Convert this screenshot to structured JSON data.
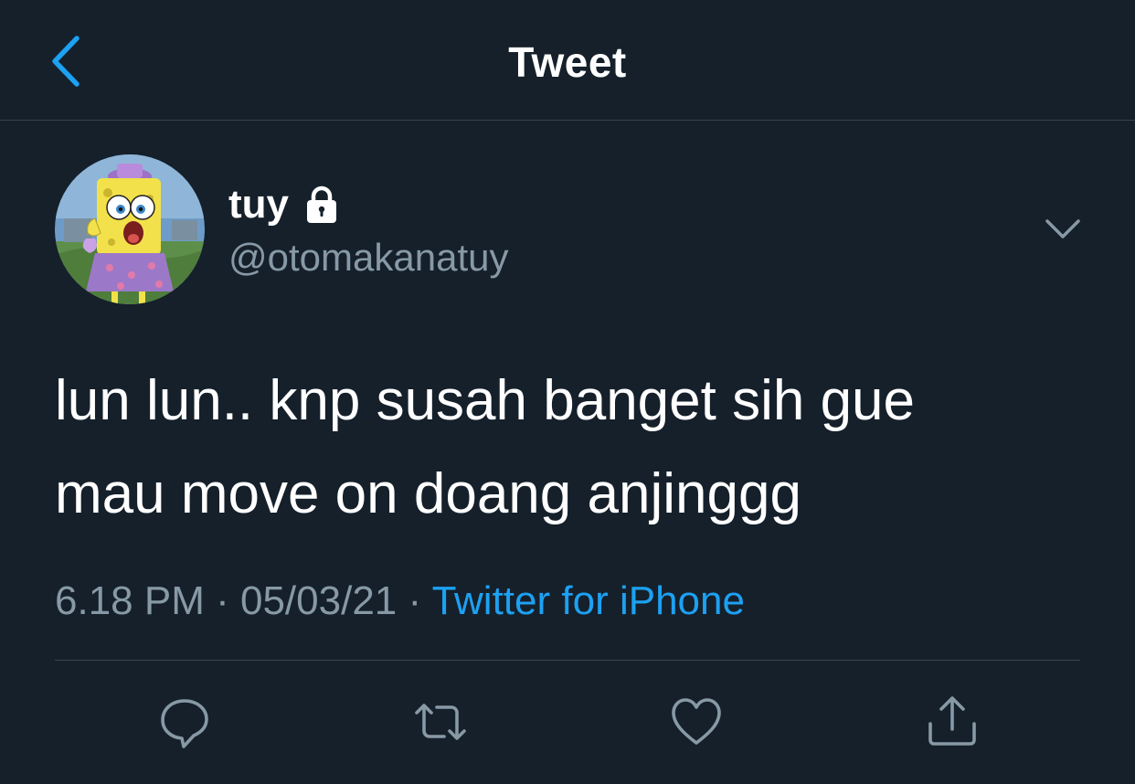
{
  "header": {
    "title": "Tweet",
    "back_icon": "chevron-left-icon"
  },
  "tweet": {
    "author": {
      "display_name": "tuy",
      "handle": "@otomakanatuy",
      "protected_icon": "lock-icon",
      "avatar": "avatar-image"
    },
    "text_lines": [
      "lun lun.. knp susah banget sih gue",
      "mau move on doang anjinggg"
    ],
    "time": "6.18 PM",
    "separator": " · ",
    "date": "05/03/21",
    "source": "Twitter for iPhone",
    "more_icon": "chevron-down-icon"
  },
  "actions": [
    {
      "name": "reply",
      "icon": "reply-icon"
    },
    {
      "name": "retweet",
      "icon": "retweet-icon"
    },
    {
      "name": "like",
      "icon": "heart-icon"
    },
    {
      "name": "share",
      "icon": "share-icon"
    }
  ],
  "colors": {
    "background": "#15202b",
    "accent": "#1da1f2",
    "secondary_text": "#8899a6",
    "divider": "#38444d"
  }
}
